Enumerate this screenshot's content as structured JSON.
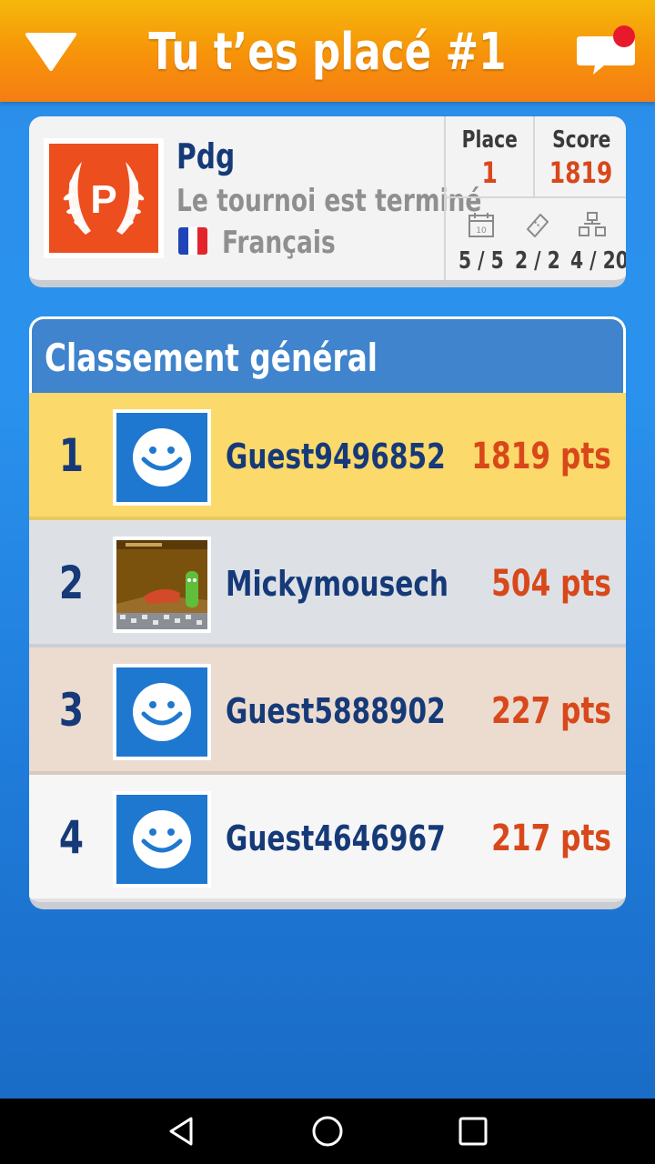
{
  "header": {
    "title": "Tu t’es placé #1",
    "menu_icon": "dropdown-triangle-icon",
    "chat_icon": "chat-bubble-icon",
    "notification_color": "#e8192c"
  },
  "profile": {
    "badge_letter": "P",
    "name": "Pdg",
    "status": "Le tournoi est terminé",
    "language": "Français",
    "place_label": "Place",
    "place_value": "1",
    "score_label": "Score",
    "score_value": "1819",
    "days": "5 / 5",
    "tickets": "2 / 2",
    "players": "4 / 20"
  },
  "ranking": {
    "title": "Classement général",
    "rows": [
      {
        "rank": "1",
        "name": "Guest9496852",
        "score": "1819 pts",
        "avatar": "smiley-avatar",
        "bg": "#fbd96a"
      },
      {
        "rank": "2",
        "name": "Mickymousech",
        "score": "504 pts",
        "avatar": "game-scene-avatar",
        "bg": "#dde1e6"
      },
      {
        "rank": "3",
        "name": "Guest5888902",
        "score": "227 pts",
        "avatar": "smiley-avatar",
        "bg": "#ecdcd0"
      },
      {
        "rank": "4",
        "name": "Guest4646967",
        "score": "217 pts",
        "avatar": "smiley-avatar",
        "bg": "#f6f6f6"
      }
    ]
  },
  "colors": {
    "accent_orange": "#f7920a",
    "score_red": "#d8481b",
    "name_navy": "#163a78",
    "header_blue": "#3f84cc"
  }
}
